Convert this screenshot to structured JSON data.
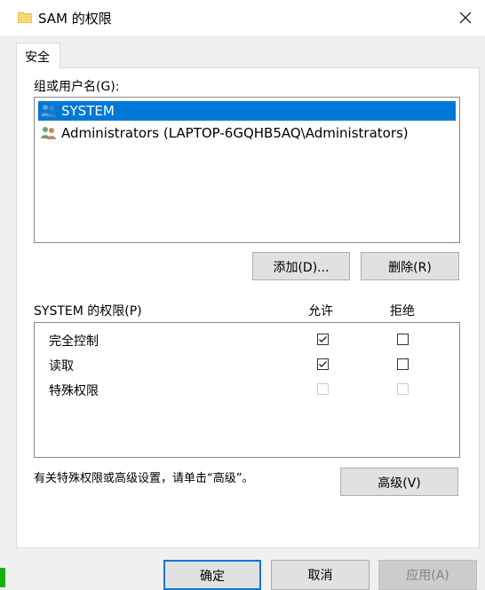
{
  "window": {
    "title": "SAM 的权限"
  },
  "tabs": [
    {
      "label": "安全"
    }
  ],
  "users_section": {
    "label": "组或用户名(G):",
    "items": [
      {
        "label": "SYSTEM",
        "selected": true,
        "icon": "user-group-icon"
      },
      {
        "label": "Administrators (LAPTOP-6GQHB5AQ\\Administrators)",
        "selected": false,
        "icon": "user-group-icon"
      }
    ],
    "add_label": "添加(D)...",
    "remove_label": "删除(R)"
  },
  "permissions_section": {
    "label": "SYSTEM 的权限(P)",
    "allow_header": "允许",
    "deny_header": "拒绝",
    "rows": [
      {
        "name": "完全控制",
        "allow": true,
        "deny": false,
        "disabled": false
      },
      {
        "name": "读取",
        "allow": true,
        "deny": false,
        "disabled": false
      },
      {
        "name": "特殊权限",
        "allow": false,
        "deny": false,
        "disabled": true
      }
    ]
  },
  "advanced": {
    "text": "有关特殊权限或高级设置，请单击“高级”。",
    "button_label": "高级(V)"
  },
  "footer": {
    "ok_label": "确定",
    "cancel_label": "取消",
    "apply_label": "应用(A)"
  },
  "colors": {
    "accent": "#0078d7",
    "selection": "#0078d7",
    "folder": "#f8d775"
  }
}
